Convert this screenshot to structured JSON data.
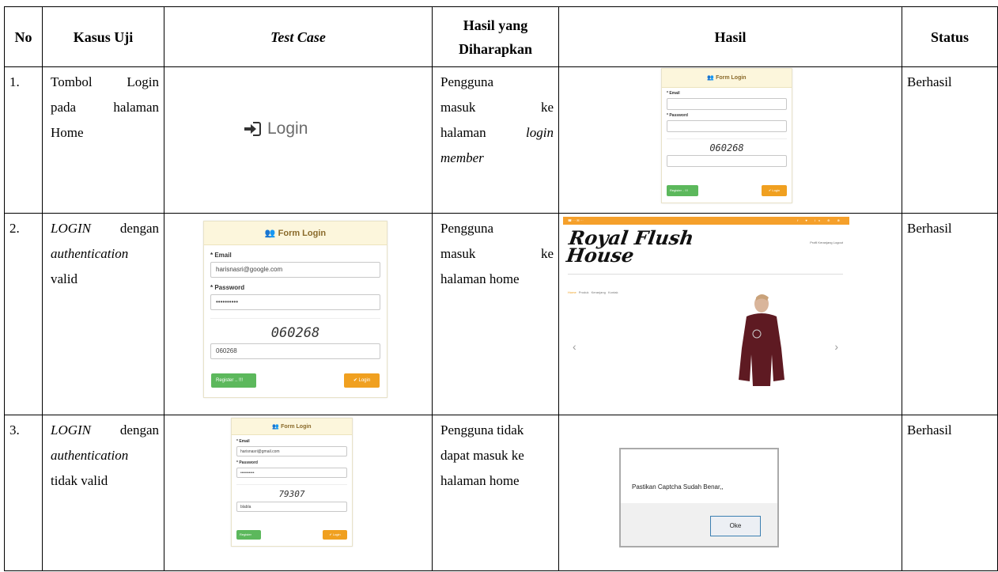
{
  "headers": {
    "no": "No",
    "kasus_uji": "Kasus Uji",
    "test_case": "Test Case",
    "hasil_diharapkan_1": "Hasil yang",
    "hasil_diharapkan_2": "Diharapkan",
    "hasil": "Hasil",
    "status": "Status"
  },
  "rows": [
    {
      "no": "1.",
      "kasus": [
        "Tombol",
        "Login",
        "pada",
        "halaman",
        "Home"
      ],
      "test_case": {
        "button_label": "Login"
      },
      "expected": [
        "Pengguna",
        "masuk",
        "ke",
        "halaman",
        "login",
        "member"
      ],
      "status": "Berhasil"
    },
    {
      "no": "2.",
      "kasus": [
        "LOGIN",
        "dengan",
        "authentication",
        "valid"
      ],
      "expected": [
        "Pengguna",
        "masuk",
        "ke",
        "halaman home"
      ],
      "status": "Berhasil"
    },
    {
      "no": "3.",
      "kasus": [
        "LOGIN",
        "dengan",
        "authentication",
        "tidak valid"
      ],
      "expected": [
        "Pengguna tidak",
        "dapat masuk ke",
        "halaman home"
      ],
      "status": "Berhasil"
    }
  ],
  "form": {
    "title": "Form Login",
    "email_label": "* Email",
    "password_label": "* Password",
    "register_label": "Register .. !!!",
    "register_short": "Register",
    "login_label": "✔ Login"
  },
  "form_row1": {
    "captcha": "060268"
  },
  "form_row2": {
    "email": "harisnasri@google.com",
    "password": "••••••••••",
    "captcha": "060268",
    "captcha_input": "060268"
  },
  "form_row3": {
    "email": "harisnasri@gmail.com",
    "password": "••••••••••",
    "captcha": "79307",
    "captcha_input": "blabla"
  },
  "site": {
    "logo_1": "Royal Flush",
    "logo_2": "House",
    "nav_home": "Home",
    "nav_produk": "Produk",
    "nav_keranjang": "Keranjang",
    "nav_kontak": "Kontak",
    "user_nav": "Profil   Keranjang   Logout"
  },
  "alert": {
    "message": "Pastikan Captcha Sudah Benar,,",
    "ok": "Oke"
  }
}
